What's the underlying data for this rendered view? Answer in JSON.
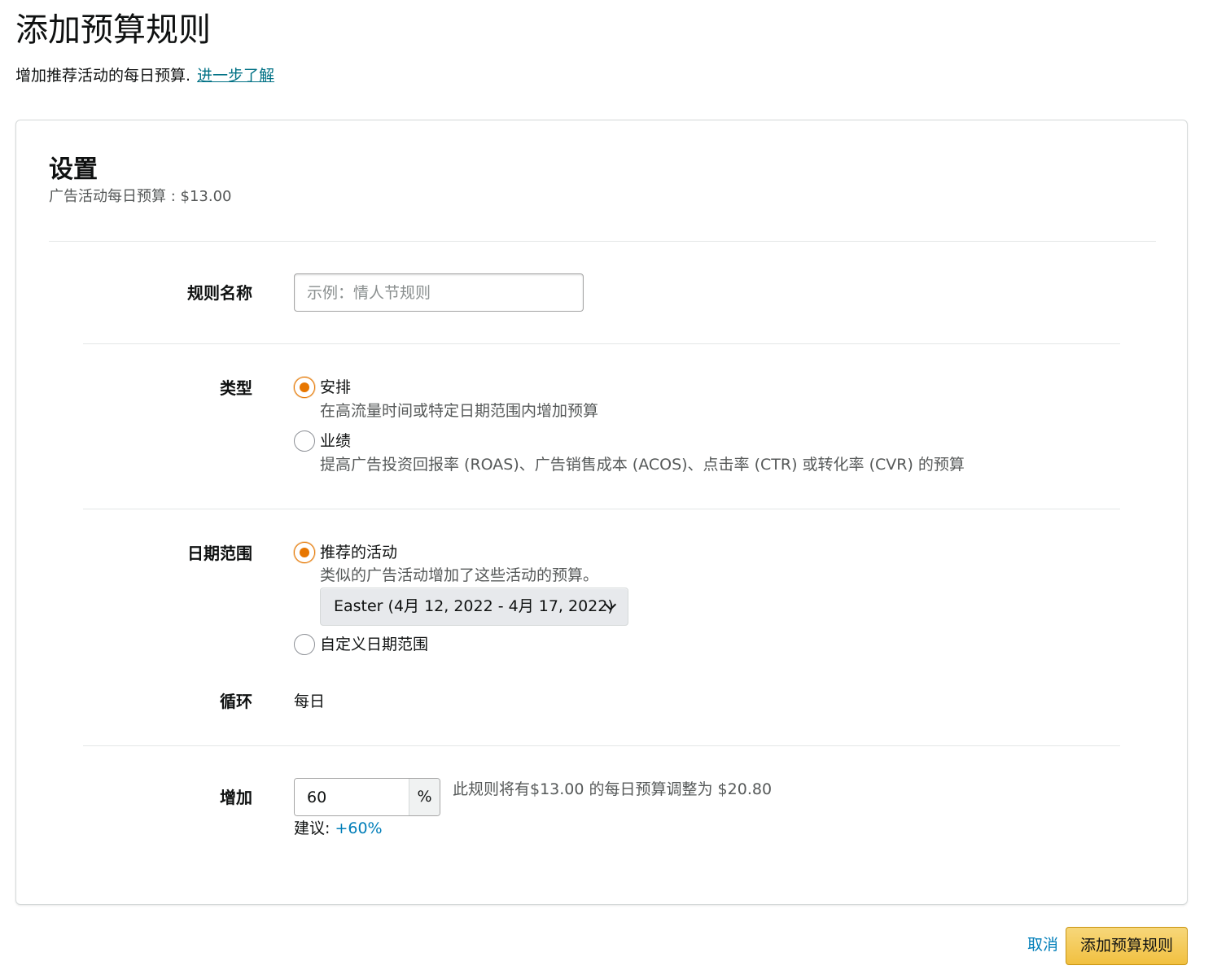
{
  "header": {
    "title": "添加预算规则",
    "subtitle": "增加推荐活动的每日预算.",
    "learn_more": "进一步了解"
  },
  "settings": {
    "title": "设置",
    "daily_budget_label": "广告活动每日预算 : $13.00"
  },
  "rule_name": {
    "label": "规则名称",
    "value": "",
    "placeholder": "示例：情人节规则"
  },
  "type": {
    "label": "类型",
    "options": [
      {
        "label": "安排",
        "description": "在高流量时间或特定日期范围内增加预算",
        "selected": true
      },
      {
        "label": "业绩",
        "description": "提高广告投资回报率 (ROAS)、广告销售成本 (ACOS)、点击率 (CTR) 或转化率 (CVR) 的预算",
        "selected": false
      }
    ]
  },
  "date_range": {
    "label": "日期范围",
    "options": [
      {
        "label": "推荐的活动",
        "description": "类似的广告活动增加了这些活动的预算。",
        "selected": true
      },
      {
        "label": "自定义日期范围",
        "selected": false
      }
    ],
    "event_select": "Easter (4月 12, 2022 - 4月 17, 2022)"
  },
  "recurrence": {
    "label": "循环",
    "value": "每日"
  },
  "increase": {
    "label": "增加",
    "value": "60",
    "unit": "%",
    "hint": "此规则将有$13.00 的每日预算调整为 $20.80",
    "suggestion_label": "建议:",
    "suggestion_value": "+60%"
  },
  "footer": {
    "cancel": "取消",
    "submit": "添加预算规则"
  },
  "colors": {
    "accent_radio": "#e77600",
    "link": "#007185",
    "primary_button": "#f1c040"
  }
}
